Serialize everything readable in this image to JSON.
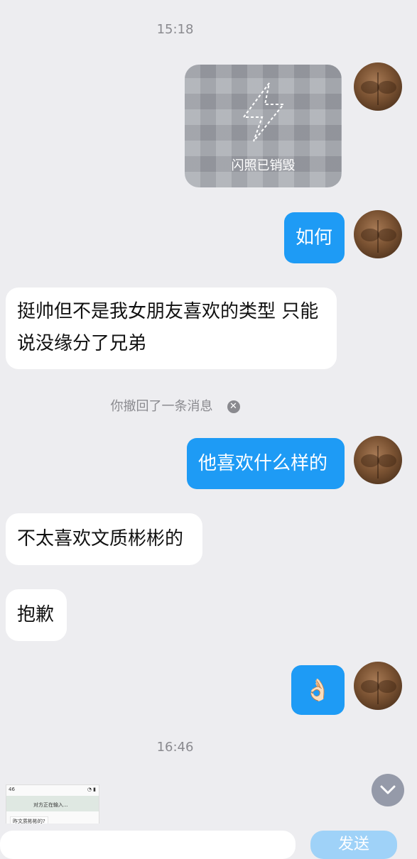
{
  "timestamps": {
    "t1": "15:18",
    "t2": "16:46"
  },
  "flash_photo": {
    "label": "闪照已销毁"
  },
  "messages": {
    "m1": "如何",
    "m2": "挺帅但不是我女朋友喜欢的类型 只能说没缘分了兄弟",
    "m4": "他喜欢什么样的",
    "m5": "不太喜欢文质彬彬的",
    "m6": "抱歉",
    "m7": "👌🏻"
  },
  "recall_notice": "你撤回了一条消息",
  "thumbnail": {
    "status_left": "46",
    "typing": "对方正在输入...",
    "msg": "昨文质彬彬的?"
  },
  "composer": {
    "send_label": "发送"
  },
  "colors": {
    "outgoing_bubble": "#1e9bf5",
    "incoming_bubble": "#ffffff",
    "background": "#ededf0"
  }
}
